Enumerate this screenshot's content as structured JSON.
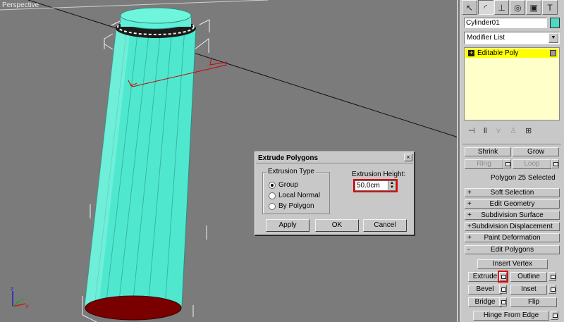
{
  "viewport": {
    "label": "Perspective"
  },
  "axis": {
    "x": "x",
    "y": "y",
    "z": "z"
  },
  "command_panel": {
    "tabs": [
      {
        "icon": "pointer-icon",
        "glyph": "↖"
      },
      {
        "icon": "curve-icon",
        "glyph": "◜"
      },
      {
        "icon": "hierarchy-icon",
        "glyph": "⊥"
      },
      {
        "icon": "motion-icon",
        "glyph": "◎"
      },
      {
        "icon": "display-icon",
        "glyph": "▣"
      },
      {
        "icon": "hammer-icon",
        "glyph": "T"
      }
    ],
    "object_name": "Cylinder01",
    "object_color": "#4fd8c2",
    "modifier_list": "Modifier List",
    "stack": {
      "item": "Editable Poly",
      "highlight": "#ffff00"
    },
    "selection": {
      "shrink": "Shrink",
      "grow": "Grow",
      "ring": "Ring",
      "loop": "Loop",
      "status": "Polygon 25 Selected"
    },
    "rollouts": [
      {
        "sign": "+",
        "label": "Soft Selection"
      },
      {
        "sign": "+",
        "label": "Edit Geometry"
      },
      {
        "sign": "+",
        "label": "Subdivision Surface"
      },
      {
        "sign": "+",
        "label": "Subdivision Displacement"
      },
      {
        "sign": "+",
        "label": "Paint Deformation"
      },
      {
        "sign": "-",
        "label": "Edit Polygons"
      }
    ],
    "edit_polygons": {
      "insert_vertex": "Insert Vertex",
      "extrude": "Extrude",
      "outline": "Outline",
      "bevel": "Bevel",
      "inset": "Inset",
      "bridge": "Bridge",
      "flip": "Flip",
      "hinge": "Hinge From Edge"
    }
  },
  "dialog": {
    "title": "Extrude Polygons",
    "close": "×",
    "group_label": "Extrusion Type",
    "options": [
      "Group",
      "Local Normal",
      "By Polygon"
    ],
    "selected_option": "Group",
    "height_label": "Extrusion Height:",
    "height_value": "50.0cm",
    "apply": "Apply",
    "ok": "OK",
    "cancel": "Cancel"
  },
  "colors": {
    "cylinder": "#4fe8cf",
    "cap": "#7a0000",
    "viewport_bg": "#7b7b7b",
    "highlight_red": "#e00000"
  }
}
